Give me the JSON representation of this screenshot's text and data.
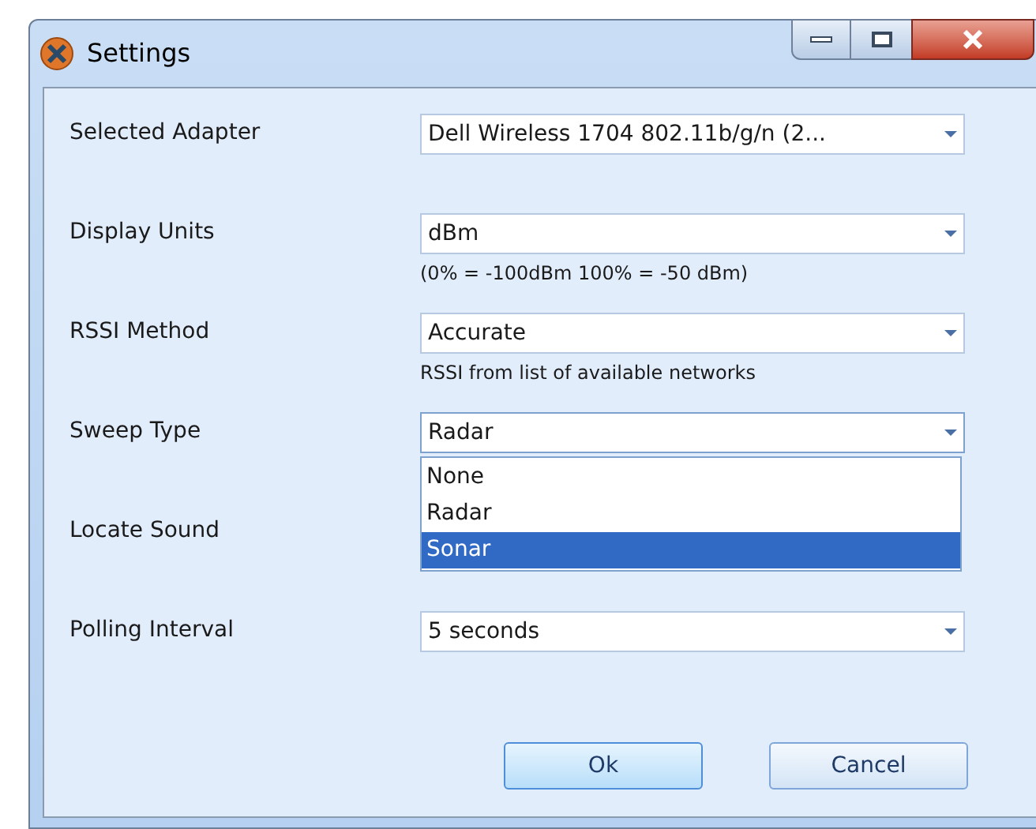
{
  "window": {
    "title": "Settings"
  },
  "fields": [
    {
      "label": "Selected Adapter",
      "value": "Dell Wireless 1704 802.11b/g/n (2...",
      "expanded": false
    },
    {
      "label": "Display Units",
      "value": "dBm",
      "note": "(0% = -100dBm 100% = -50 dBm)",
      "expanded": false
    },
    {
      "label": "RSSI Method",
      "value": "Accurate",
      "note": "RSSI from list of available networks",
      "expanded": false
    },
    {
      "label": "Sweep Type",
      "value": "Radar",
      "expanded": true,
      "options": [
        {
          "label": "None",
          "highlighted": false
        },
        {
          "label": "Radar",
          "highlighted": false
        },
        {
          "label": "Sonar",
          "highlighted": true
        }
      ]
    },
    {
      "label": "Locate Sound"
    },
    {
      "label": "Polling Interval",
      "value": "5 seconds",
      "expanded": false
    }
  ],
  "buttons": [
    "Ok",
    "Cancel"
  ]
}
